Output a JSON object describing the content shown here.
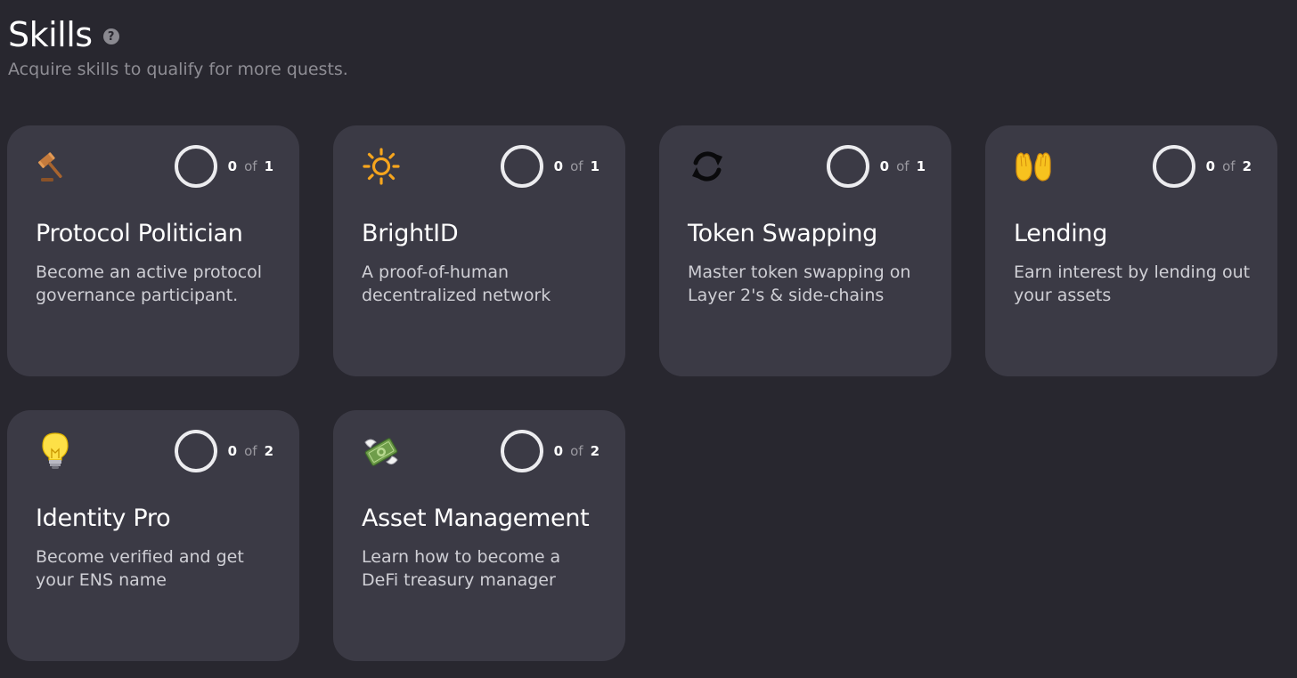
{
  "header": {
    "title": "Skills",
    "help_icon": "?",
    "subtitle": "Acquire skills to qualify for more quests."
  },
  "skills": [
    {
      "icon": "gavel-icon",
      "title": "Protocol Politician",
      "description": "Become an active protocol governance participant.",
      "progress": "0",
      "of": "of",
      "total": "1"
    },
    {
      "icon": "sun-icon",
      "title": "BrightID",
      "description": "A proof-of-human decentralized network",
      "progress": "0",
      "of": "of",
      "total": "1"
    },
    {
      "icon": "swap-arrows-icon",
      "title": "Token Swapping",
      "description": "Master token swapping on Layer 2's & side-chains",
      "progress": "0",
      "of": "of",
      "total": "1"
    },
    {
      "icon": "open-hands-icon",
      "title": "Lending",
      "description": "Earn interest by lending out your assets",
      "progress": "0",
      "of": "of",
      "total": "2"
    },
    {
      "icon": "lightbulb-icon",
      "title": "Identity Pro",
      "description": "Become verified and get your ENS name",
      "progress": "0",
      "of": "of",
      "total": "2"
    },
    {
      "icon": "money-wings-icon",
      "title": "Asset Management",
      "description": "Learn how to become a DeFi treasury manager",
      "progress": "0",
      "of": "of",
      "total": "2"
    }
  ],
  "colors": {
    "background": "#28272f",
    "card": "#3b3a45",
    "subtitle": "#8e8d94"
  }
}
